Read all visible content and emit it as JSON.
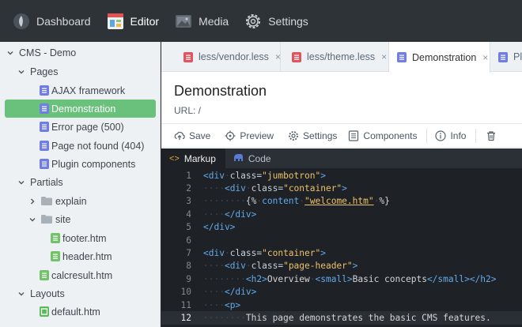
{
  "nav": [
    {
      "label": "Dashboard",
      "icon": "leaf-icon"
    },
    {
      "label": "Editor",
      "icon": "editor-icon",
      "active": true
    },
    {
      "label": "Media",
      "icon": "image-icon"
    },
    {
      "label": "Settings",
      "icon": "gear-icon"
    }
  ],
  "sidebar": {
    "root": "CMS - Demo",
    "pages_label": "Pages",
    "pages": [
      "AJAX framework",
      "Demonstration",
      "Error page (500)",
      "Page not found (404)",
      "Plugin components"
    ],
    "partials_label": "Partials",
    "folder_explain": "explain",
    "folder_site": "site",
    "site_files": [
      "footer.htm",
      "header.htm"
    ],
    "calcresult": "calcresult.htm",
    "layouts_label": "Layouts",
    "layout_file": "default.htm"
  },
  "tabs": [
    {
      "label": "less/vendor.less",
      "close": "×"
    },
    {
      "label": "less/theme.less",
      "close": "×"
    },
    {
      "label": "Demonstration",
      "close": "×"
    },
    {
      "label": "Pl"
    }
  ],
  "doc": {
    "title": "Demonstration",
    "url": "URL: /"
  },
  "toolbar": {
    "save": "Save",
    "preview": "Preview",
    "settings": "Settings",
    "components": "Components",
    "info": "Info"
  },
  "editor": {
    "tab_markup": "Markup",
    "tab_code": "Code",
    "current_line": 12,
    "lines": [
      "1",
      "2",
      "3",
      "4",
      "5",
      "6",
      "7",
      "8",
      "9",
      "10",
      "11",
      "12"
    ],
    "code": {
      "l1_tag": "<div",
      "l1_attr": "class=",
      "l1_val": "\"jumbotron\"",
      "l1_end": ">",
      "l2_tag": "<div",
      "l2_attr": "class=",
      "l2_val": "\"container\"",
      "l2_end": ">",
      "l3_open": "{%",
      "l3_kw": "content",
      "l3_val": "\"welcome.htm\"",
      "l3_close": "%}",
      "l4": "</div>",
      "l5": "</div>",
      "l7_tag": "<div",
      "l7_attr": "class=",
      "l7_val": "\"container\"",
      "l7_end": ">",
      "l8_tag": "<div",
      "l8_attr": "class=",
      "l8_val": "\"page-header\"",
      "l8_end": ">",
      "l9_h2": "<h2>",
      "l9_text": "Overview",
      "l9_small": "<small>",
      "l9_stext": "Basic concepts",
      "l9_sclose": "</small>",
      "l9_h2close": "</h2>",
      "l10": "</div>",
      "l11": "<p>",
      "l12": "This page demonstrates the basic CMS features."
    }
  },
  "colors": {
    "accent": "#6ac17c",
    "nav_bg": "#2e3338",
    "page_icon": "#6f7ee0",
    "less_icon": "#e0545f",
    "partial_icon": "#72c269"
  }
}
